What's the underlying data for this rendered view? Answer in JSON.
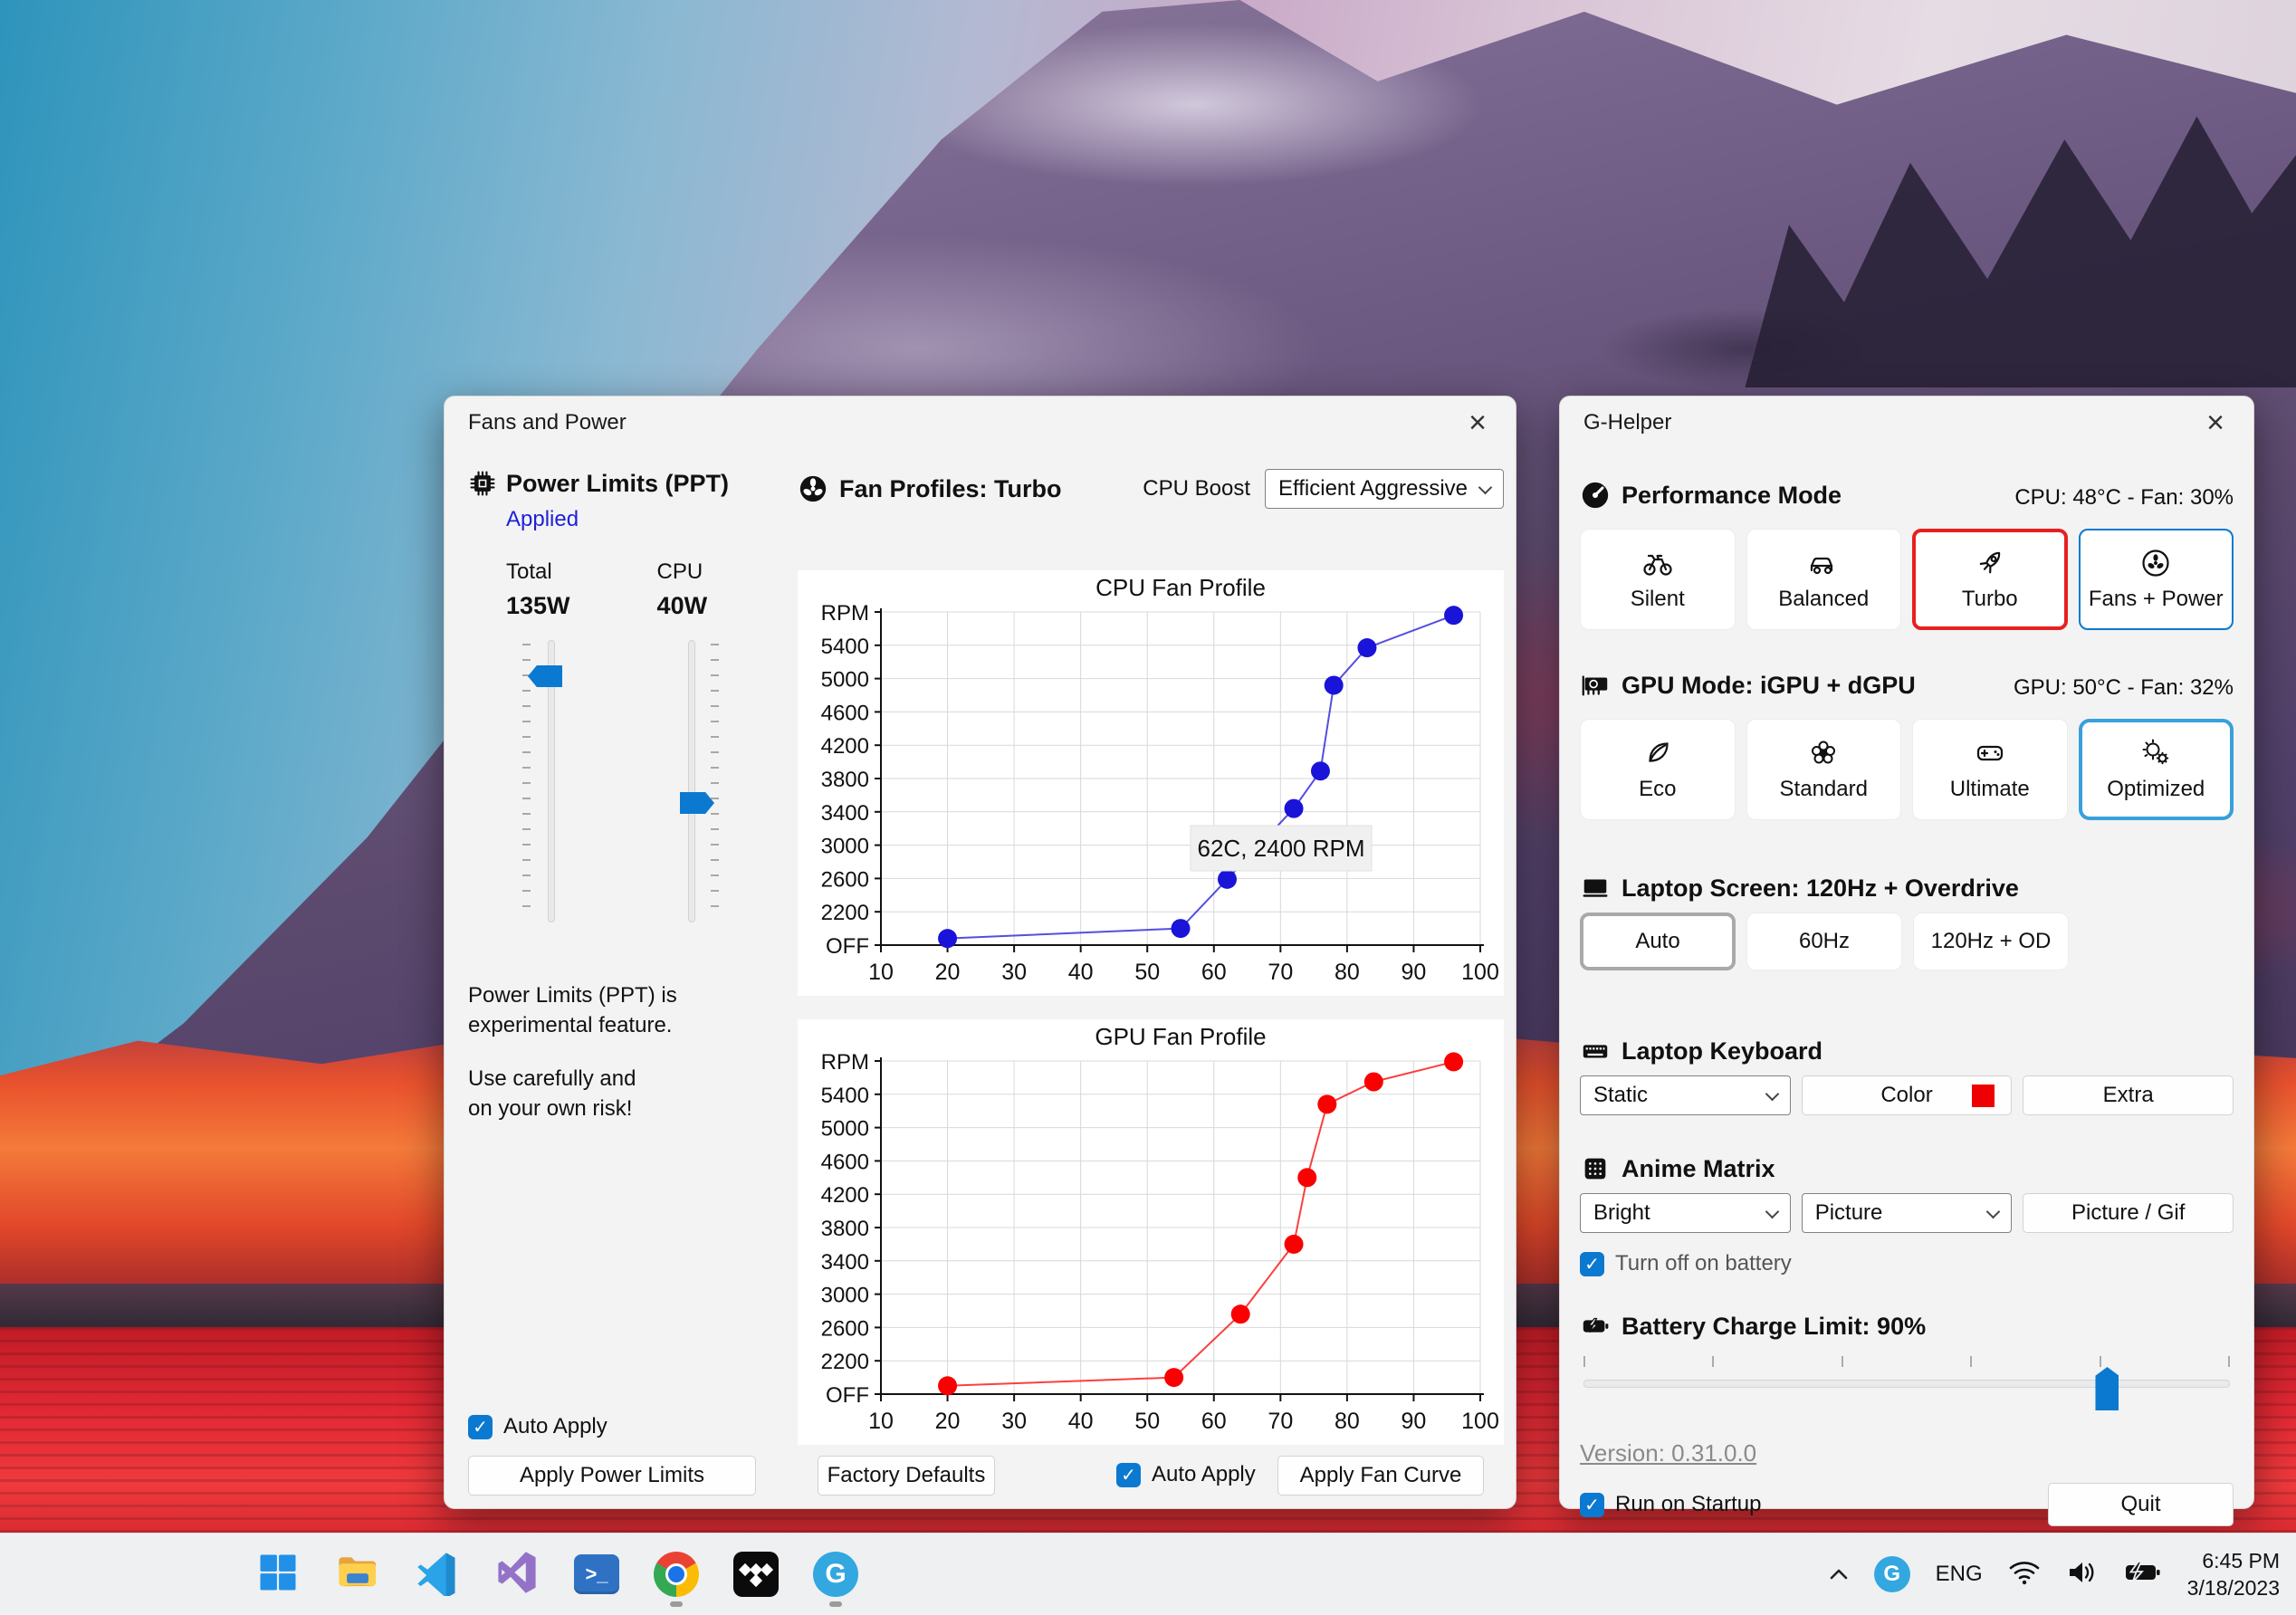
{
  "colors": {
    "accent": "#0b79d0",
    "selected_red": "#e7201f",
    "selected_blue": "#38a0db",
    "link": "#2020d8",
    "keyboard_swatch": "#ee0000"
  },
  "icons": {
    "close": "×",
    "check": "✓"
  },
  "fans_window": {
    "title": "Fans and Power",
    "power_limits": {
      "heading": "Power Limits (PPT)",
      "status": "Applied",
      "total_label": "Total",
      "total_value": "135W",
      "cpu_label": "CPU",
      "cpu_value": "40W",
      "note_lines": [
        "Power Limits (PPT) is",
        "experimental feature.",
        "Use carefully and",
        "on your own risk!"
      ],
      "auto_apply": "Auto Apply",
      "apply_button": "Apply Power Limits"
    },
    "fan_profiles": {
      "heading": "Fan Profiles: Turbo",
      "cpu_boost_label": "CPU Boost",
      "cpu_boost_value": "Efficient Aggressive",
      "factory_defaults": "Factory Defaults",
      "auto_apply": "Auto Apply",
      "apply_fan_curve": "Apply Fan Curve"
    }
  },
  "chart_data": [
    {
      "type": "line",
      "title": "CPU Fan Profile",
      "x": [
        20,
        55,
        62,
        72,
        76,
        78,
        83,
        96
      ],
      "y": [
        1880,
        2000,
        2590,
        3440,
        3890,
        4920,
        5370,
        5760
      ],
      "xticks": [
        10,
        20,
        30,
        40,
        50,
        60,
        70,
        80,
        90,
        100
      ],
      "ytick_values": [
        1800,
        2200,
        2600,
        3000,
        3400,
        3800,
        4200,
        4600,
        5000,
        5400,
        5800
      ],
      "ytick_labels": [
        "OFF",
        "2200",
        "2600",
        "3000",
        "3400",
        "3800",
        "4200",
        "4600",
        "5000",
        "5400",
        "RPM"
      ],
      "xlim": [
        10,
        100
      ],
      "ylim": [
        1800,
        5800
      ],
      "grid": true,
      "color": "#1a14d8",
      "tooltip": "62C, 2400 RPM"
    },
    {
      "type": "line",
      "title": "GPU Fan Profile",
      "x": [
        20,
        54,
        64,
        72,
        74,
        77,
        84,
        96
      ],
      "y": [
        1900,
        2000,
        2760,
        3600,
        4400,
        5280,
        5550,
        5790
      ],
      "xticks": [
        10,
        20,
        30,
        40,
        50,
        60,
        70,
        80,
        90,
        100
      ],
      "ytick_values": [
        1800,
        2200,
        2600,
        3000,
        3400,
        3800,
        4200,
        4600,
        5000,
        5400,
        5800
      ],
      "ytick_labels": [
        "OFF",
        "2200",
        "2600",
        "3000",
        "3400",
        "3800",
        "4200",
        "4600",
        "5000",
        "5400",
        "RPM"
      ],
      "xlim": [
        10,
        100
      ],
      "ylim": [
        1800,
        5800
      ],
      "grid": true,
      "color": "#fa0000",
      "tooltip": ""
    }
  ],
  "ghelper": {
    "title": "G-Helper",
    "performance": {
      "heading": "Performance Mode",
      "status": "CPU: 48°C -  Fan: 30%",
      "modes": [
        "Silent",
        "Balanced",
        "Turbo",
        "Fans + Power"
      ],
      "selected": "Turbo"
    },
    "gpu": {
      "heading": "GPU Mode: iGPU + dGPU",
      "status": "GPU: 50°C -  Fan: 32%",
      "modes": [
        "Eco",
        "Standard",
        "Ultimate",
        "Optimized"
      ],
      "selected": "Optimized"
    },
    "screen": {
      "heading": "Laptop Screen: 120Hz + Overdrive",
      "options": [
        "Auto",
        "60Hz",
        "120Hz + OD"
      ],
      "selected": "Auto"
    },
    "keyboard": {
      "heading": "Laptop Keyboard",
      "mode_value": "Static",
      "color_button": "Color",
      "extra_button": "Extra"
    },
    "matrix": {
      "heading": "Anime Matrix",
      "brightness_value": "Bright",
      "mode_value": "Picture",
      "button": "Picture / Gif",
      "battery_checkbox": "Turn off on battery"
    },
    "battery": {
      "heading": "Battery Charge Limit: 90%",
      "percent": 90
    },
    "version": "Version: 0.31.0.0",
    "run_on_startup": "Run on Startup",
    "quit": "Quit"
  },
  "taskbar": {
    "language": "ENG",
    "time": "6:45 PM",
    "date": "3/18/2023"
  }
}
